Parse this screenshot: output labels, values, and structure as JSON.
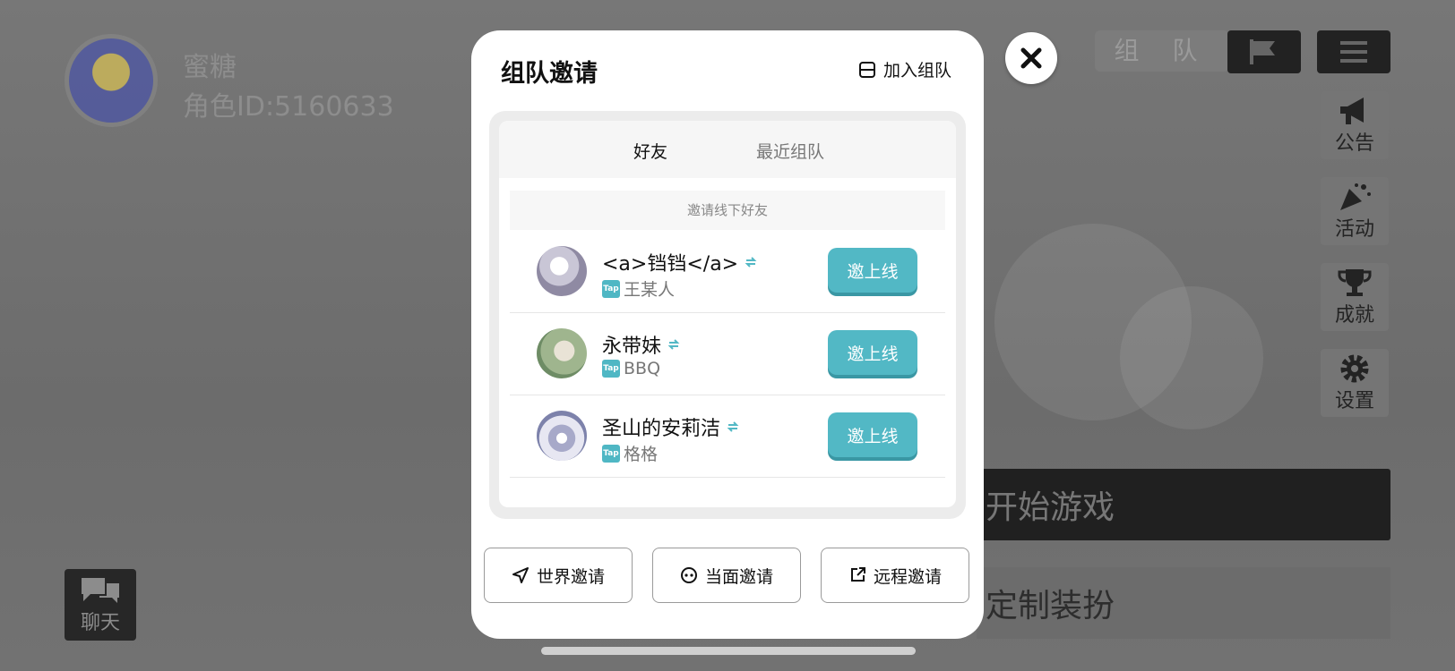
{
  "background": {
    "player": {
      "name": "蜜糖",
      "id_label": "角色ID:5160633"
    },
    "top_bar": {
      "team_label": "组 队"
    },
    "side_menu": [
      {
        "label": "公告",
        "icon": "megaphone-icon"
      },
      {
        "label": "活动",
        "icon": "party-popper-icon"
      },
      {
        "label": "成就",
        "icon": "trophy-icon"
      },
      {
        "label": "设置",
        "icon": "gear-icon"
      }
    ],
    "start_game_label": "开始游戏",
    "custom_outfit_label": "定制装扮",
    "chat_label": "聊天"
  },
  "modal": {
    "title": "组队邀请",
    "join_team_label": "加入组队",
    "tabs": [
      {
        "label": "好友",
        "active": true
      },
      {
        "label": "最近组队",
        "active": false
      }
    ],
    "offline_invite_label": "邀请线下好友",
    "friends": [
      {
        "name": "<a>铛铛</a>",
        "platform_badge": "Tap",
        "sub_name": "王某人",
        "action_label": "邀上线"
      },
      {
        "name": "永带妹",
        "platform_badge": "Tap",
        "sub_name": "BBQ",
        "action_label": "邀上线"
      },
      {
        "name": "圣山的安莉洁",
        "platform_badge": "Tap",
        "sub_name": "格格",
        "action_label": "邀上线"
      }
    ],
    "footer_buttons": [
      {
        "label": "世界邀请",
        "icon": "send-icon"
      },
      {
        "label": "当面邀请",
        "icon": "face-icon"
      },
      {
        "label": "远程邀请",
        "icon": "external-link-icon"
      }
    ]
  },
  "colors": {
    "accent": "#52b8c5",
    "overlay": "#6f6f6f"
  }
}
